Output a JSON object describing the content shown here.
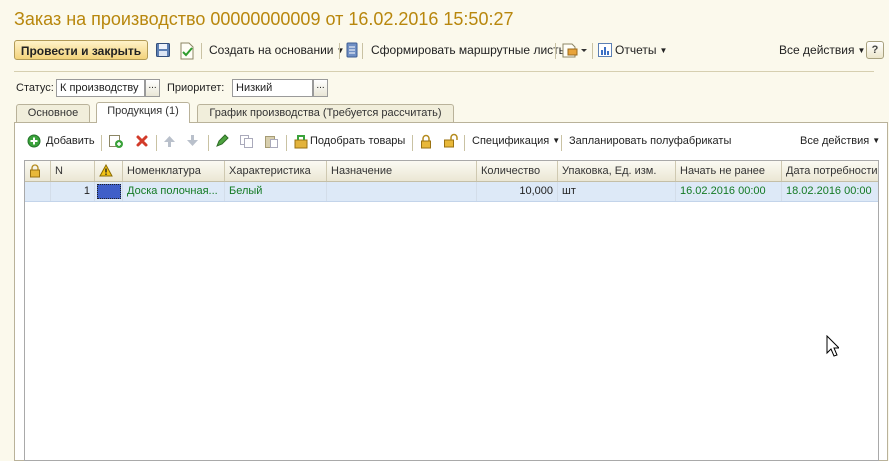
{
  "window": {
    "title": "Заказ на производство 00000000009 от 16.02.2016 15:50:27"
  },
  "command_bar": {
    "post_and_close": "Провести и закрыть",
    "create_based_on": "Создать на основании",
    "form_route_sheets": "Сформировать маршрутные листы",
    "reports": "Отчеты",
    "all_actions": "Все действия",
    "help": "?"
  },
  "form": {
    "status_label": "Статус:",
    "status_value": "К производству",
    "priority_label": "Приоритет:",
    "priority_value": "Низкий",
    "select_button": "..."
  },
  "tabs": [
    {
      "label": "Основное"
    },
    {
      "label": "Продукция (1)"
    },
    {
      "label": "График производства (Требуется рассчитать)"
    }
  ],
  "table_toolbar": {
    "add": "Добавить",
    "pick_goods": "Подобрать товары",
    "specification": "Спецификация",
    "plan_semi_finished": "Запланировать полуфабрикаты",
    "all_actions": "Все действия"
  },
  "table": {
    "columns": [
      "N",
      "Номенклатура",
      "Характеристика",
      "Назначение",
      "Количество",
      "Упаковка, Ед. изм.",
      "Начать не ранее",
      "Дата потребности"
    ],
    "rows": [
      {
        "n": "1",
        "nomenclature": "Доска полочная...",
        "characteristic": "Белый",
        "purpose": "",
        "quantity": "10,000",
        "unit": "шт",
        "start_not_before": "16.02.2016 00:00",
        "need_date": "18.02.2016 00:00"
      }
    ]
  },
  "colors": {
    "title": "#b8870d",
    "background": "#fbf9ec",
    "row_selected": "#dde9f7",
    "row_text": "#147a24"
  }
}
